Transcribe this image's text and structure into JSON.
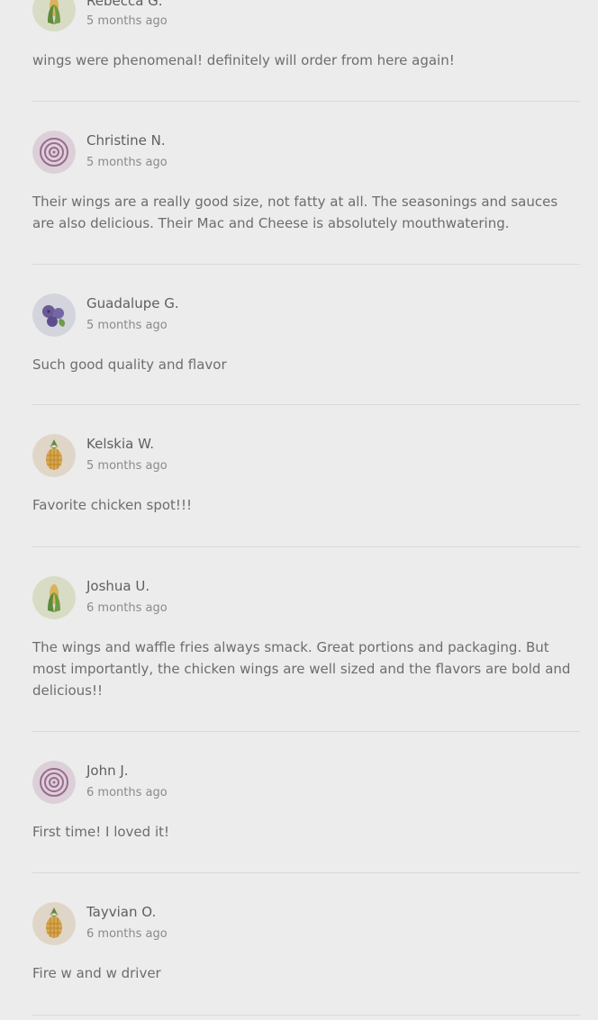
{
  "reviews": [
    {
      "name": "Rebecca G.",
      "time": "5 months ago",
      "text": "wings were phenomenal! definitely will order from here again!",
      "avatar_icon": "corn-icon"
    },
    {
      "name": "Christine N.",
      "time": "5 months ago",
      "text": "Their wings are a really good size, not fatty at all. The seasonings and sauces are also delicious. Their Mac and Cheese is absolutely mouthwatering.",
      "avatar_icon": "onion-icon"
    },
    {
      "name": "Guadalupe G.",
      "time": "5 months ago",
      "text": "Such good quality and flavor",
      "avatar_icon": "blueberry-icon"
    },
    {
      "name": "Kelskia W.",
      "time": "5 months ago",
      "text": "Favorite chicken spot!!!",
      "avatar_icon": "pineapple-icon"
    },
    {
      "name": "Joshua U.",
      "time": "6 months ago",
      "text": "The wings and waffle fries always smack. Great portions and packaging. But most importantly, the chicken wings are well sized and the flavors are bold and delicious!!",
      "avatar_icon": "corn-icon"
    },
    {
      "name": "John J.",
      "time": "6 months ago",
      "text": "First time! I loved it!",
      "avatar_icon": "onion-icon"
    },
    {
      "name": "Tayvian O.",
      "time": "6 months ago",
      "text": "Fire w and w driver",
      "avatar_icon": "pineapple-icon"
    }
  ],
  "colors": {
    "background": "#ececec",
    "divider": "#d9d9d9",
    "name_text": "#5f5f5f",
    "time_text": "#8a8a8a",
    "body_text": "#6d6d6d"
  }
}
